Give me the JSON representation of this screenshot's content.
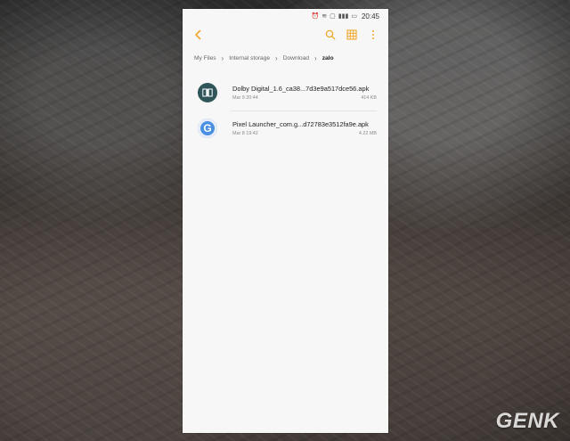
{
  "status_bar": {
    "time": "20:45"
  },
  "toolbar": {
    "back_icon": "chevron-left-icon",
    "search_icon": "search-icon",
    "grid_icon": "grid-icon",
    "more_icon": "more-vert-icon"
  },
  "breadcrumb": [
    "My Files",
    "Internal storage",
    "Download",
    "zalo"
  ],
  "files": [
    {
      "name": "Dolby Digital_1.6_ca38...7d3e9a517dce56.apk",
      "date": "Mar 9 20:44",
      "size": "414 KB"
    },
    {
      "name": "Pixel Launcher_com.g...d72783e3512fa9e.apk",
      "date": "Mar 8 19:42",
      "size": "4.22 MB"
    }
  ],
  "watermark": {
    "text": "GENK"
  },
  "colors": {
    "accent": "#f0a72b",
    "dolby_icon": "#2f5558",
    "google_icon": "#4a90e2"
  }
}
